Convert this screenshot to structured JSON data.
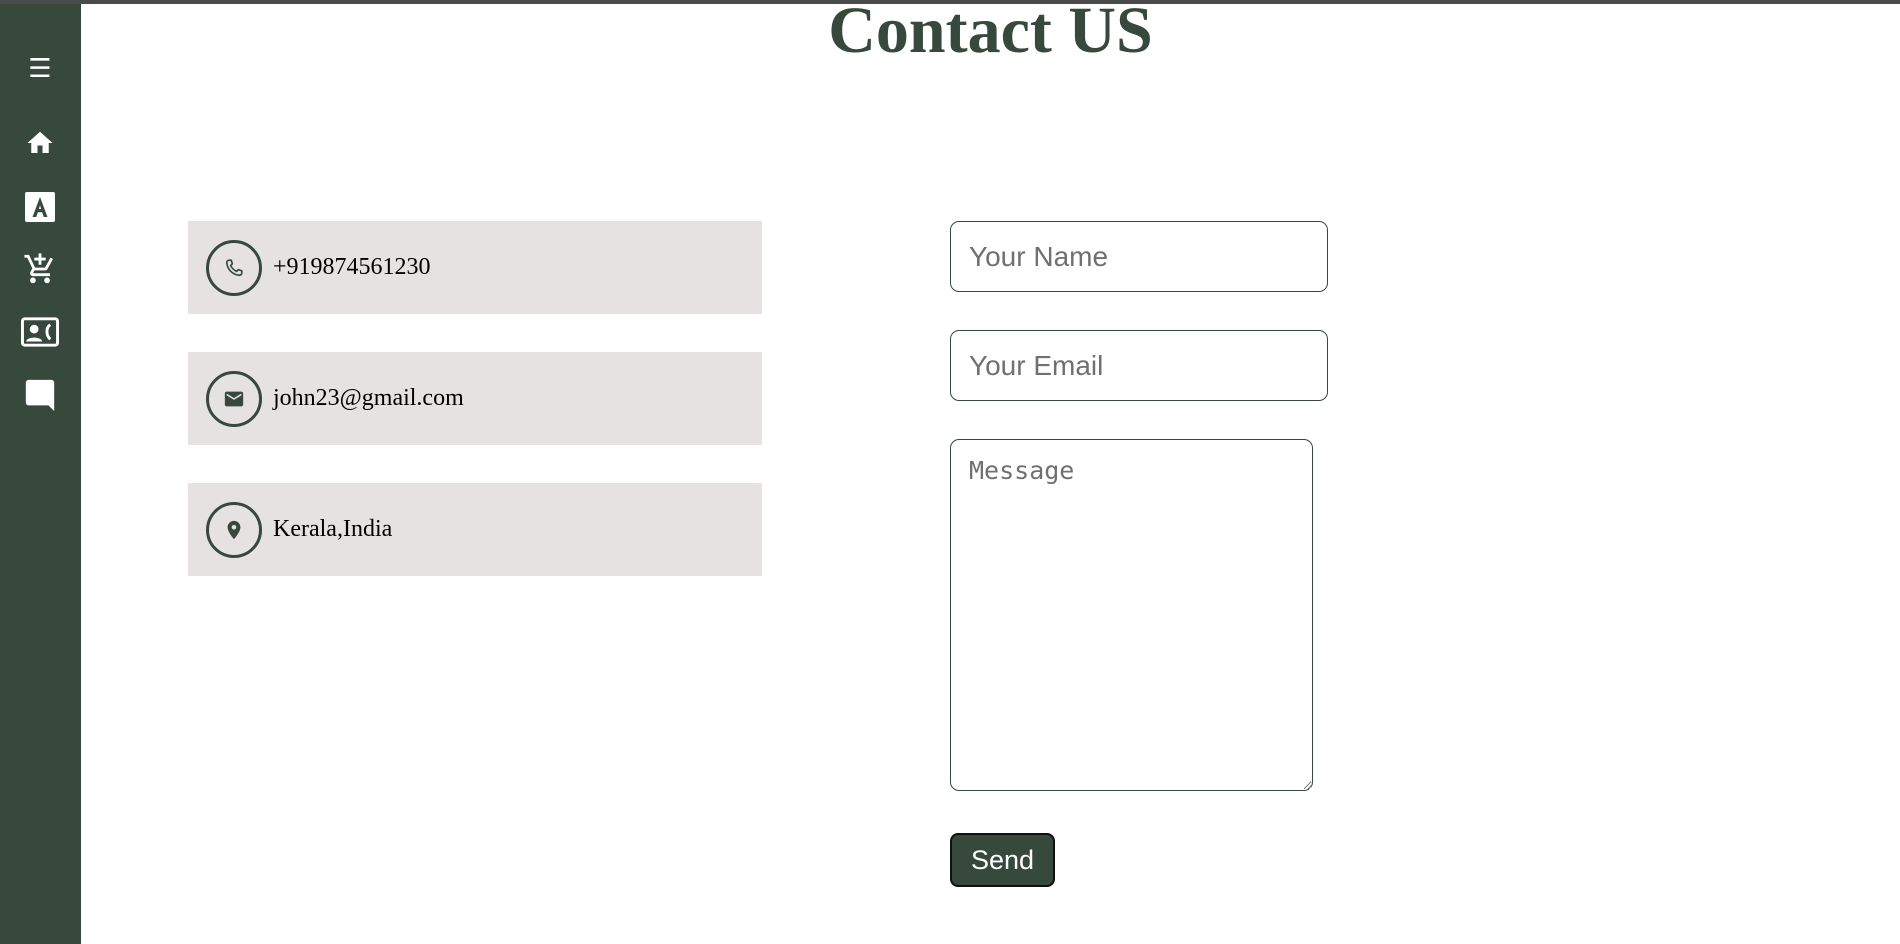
{
  "page": {
    "title": "Contact US"
  },
  "colors": {
    "primary": "#36493c",
    "card_background": "#e6e2e1",
    "top_border": "#4a4a4a"
  },
  "sidebar": {
    "menu_glyph": "☰",
    "items": [
      {
        "icon": "home-icon"
      },
      {
        "icon": "font-a-icon"
      },
      {
        "icon": "cart-icon"
      },
      {
        "icon": "contact-card-icon"
      },
      {
        "icon": "chat-icon"
      }
    ]
  },
  "contact_info": {
    "phone": {
      "icon": "phone-icon",
      "text": "+919874561230"
    },
    "email": {
      "icon": "mail-icon",
      "text": "john23@gmail.com"
    },
    "location": {
      "icon": "location-pin-icon",
      "text": "Kerala,India"
    }
  },
  "form": {
    "name_placeholder": "Your Name",
    "email_placeholder": "Your Email",
    "message_placeholder": "Message",
    "send_label": "Send"
  }
}
